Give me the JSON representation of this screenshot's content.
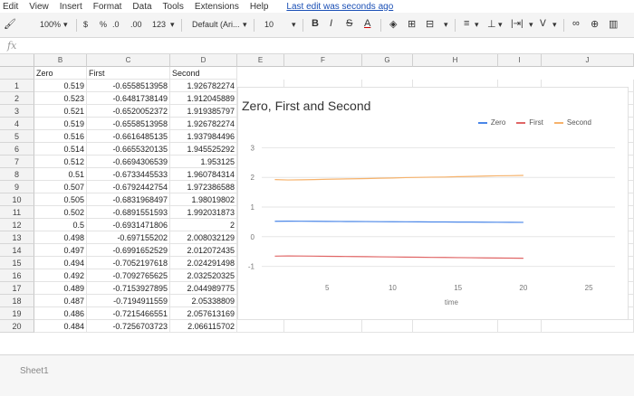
{
  "menu": {
    "items": [
      "Edit",
      "View",
      "Insert",
      "Format",
      "Data",
      "Tools",
      "Extensions",
      "Help"
    ],
    "last_edit": "Last edit was seconds ago"
  },
  "toolbar": {
    "zoom": "100%",
    "currency": "$",
    "percent": "%",
    "dec_less": ".0",
    "dec_more": ".00",
    "format_more": "123",
    "font": "Default (Ari...",
    "font_size": "10",
    "bold": "B",
    "italic": "I",
    "strike": "S",
    "underline_a": "A"
  },
  "fx": "fx",
  "columns": [
    "",
    "B",
    "C",
    "D",
    "E",
    "F",
    "G",
    "H",
    "I",
    "J"
  ],
  "headers": {
    "zero": "Zero",
    "first": "First",
    "second": "Second"
  },
  "rows": [
    {
      "n": "1",
      "zero": "0.519",
      "first": "-0.6558513958",
      "second": "1.926782274"
    },
    {
      "n": "2",
      "zero": "0.523",
      "first": "-0.6481738149",
      "second": "1.912045889"
    },
    {
      "n": "3",
      "zero": "0.521",
      "first": "-0.6520052372",
      "second": "1.919385797"
    },
    {
      "n": "4",
      "zero": "0.519",
      "first": "-0.6558513958",
      "second": "1.926782274"
    },
    {
      "n": "5",
      "zero": "0.516",
      "first": "-0.6616485135",
      "second": "1.937984496"
    },
    {
      "n": "6",
      "zero": "0.514",
      "first": "-0.6655320135",
      "second": "1.945525292"
    },
    {
      "n": "7",
      "zero": "0.512",
      "first": "-0.6694306539",
      "second": "1.953125"
    },
    {
      "n": "8",
      "zero": "0.51",
      "first": "-0.6733445533",
      "second": "1.960784314"
    },
    {
      "n": "9",
      "zero": "0.507",
      "first": "-0.6792442754",
      "second": "1.972386588"
    },
    {
      "n": "10",
      "zero": "0.505",
      "first": "-0.6831968497",
      "second": "1.98019802"
    },
    {
      "n": "11",
      "zero": "0.502",
      "first": "-0.6891551593",
      "second": "1.992031873"
    },
    {
      "n": "12",
      "zero": "0.5",
      "first": "-0.6931471806",
      "second": "2"
    },
    {
      "n": "13",
      "zero": "0.498",
      "first": "-0.697155202",
      "second": "2.008032129"
    },
    {
      "n": "14",
      "zero": "0.497",
      "first": "-0.6991652529",
      "second": "2.012072435"
    },
    {
      "n": "15",
      "zero": "0.494",
      "first": "-0.7052197618",
      "second": "2.024291498"
    },
    {
      "n": "16",
      "zero": "0.492",
      "first": "-0.7092765625",
      "second": "2.032520325"
    },
    {
      "n": "17",
      "zero": "0.489",
      "first": "-0.7153927895",
      "second": "2.044989775"
    },
    {
      "n": "18",
      "zero": "0.487",
      "first": "-0.7194911559",
      "second": "2.05338809"
    },
    {
      "n": "19",
      "zero": "0.486",
      "first": "-0.7215466551",
      "second": "2.057613169"
    },
    {
      "n": "20",
      "zero": "0.484",
      "first": "-0.7256703723",
      "second": "2.066115702"
    }
  ],
  "sheet_tab": "Sheet1",
  "chart_data": {
    "type": "line",
    "title": "Zero, First and Second",
    "xlabel": "time",
    "ylabel": "",
    "xlim": [
      0,
      27
    ],
    "ylim": [
      -1.5,
      3.5
    ],
    "xticks": [
      "5",
      "10",
      "15",
      "20",
      "25"
    ],
    "yticks": [
      "-1",
      "0",
      "1",
      "2",
      "3"
    ],
    "series": [
      {
        "name": "Zero",
        "color": "#4a86e8",
        "values": [
          0.519,
          0.523,
          0.521,
          0.519,
          0.516,
          0.514,
          0.512,
          0.51,
          0.507,
          0.505,
          0.502,
          0.5,
          0.498,
          0.497,
          0.494,
          0.492,
          0.489,
          0.487,
          0.486,
          0.484
        ]
      },
      {
        "name": "First",
        "color": "#e06666",
        "values": [
          -0.6558513958,
          -0.6481738149,
          -0.6520052372,
          -0.6558513958,
          -0.6616485135,
          -0.6655320135,
          -0.6694306539,
          -0.6733445533,
          -0.6792442754,
          -0.6831968497,
          -0.6891551593,
          -0.6931471806,
          -0.697155202,
          -0.6991652529,
          -0.7052197618,
          -0.7092765625,
          -0.7153927895,
          -0.7194911559,
          -0.7215466551,
          -0.7256703723
        ]
      },
      {
        "name": "Second",
        "color": "#f6b26b",
        "values": [
          1.926782274,
          1.912045889,
          1.919385797,
          1.926782274,
          1.937984496,
          1.945525292,
          1.953125,
          1.960784314,
          1.972386588,
          1.98019802,
          1.992031873,
          2,
          2.008032129,
          2.012072435,
          2.024291498,
          2.032520325,
          2.044989775,
          2.05338809,
          2.057613169,
          2.066115702
        ]
      }
    ],
    "grid": true,
    "legend": "top-right"
  }
}
